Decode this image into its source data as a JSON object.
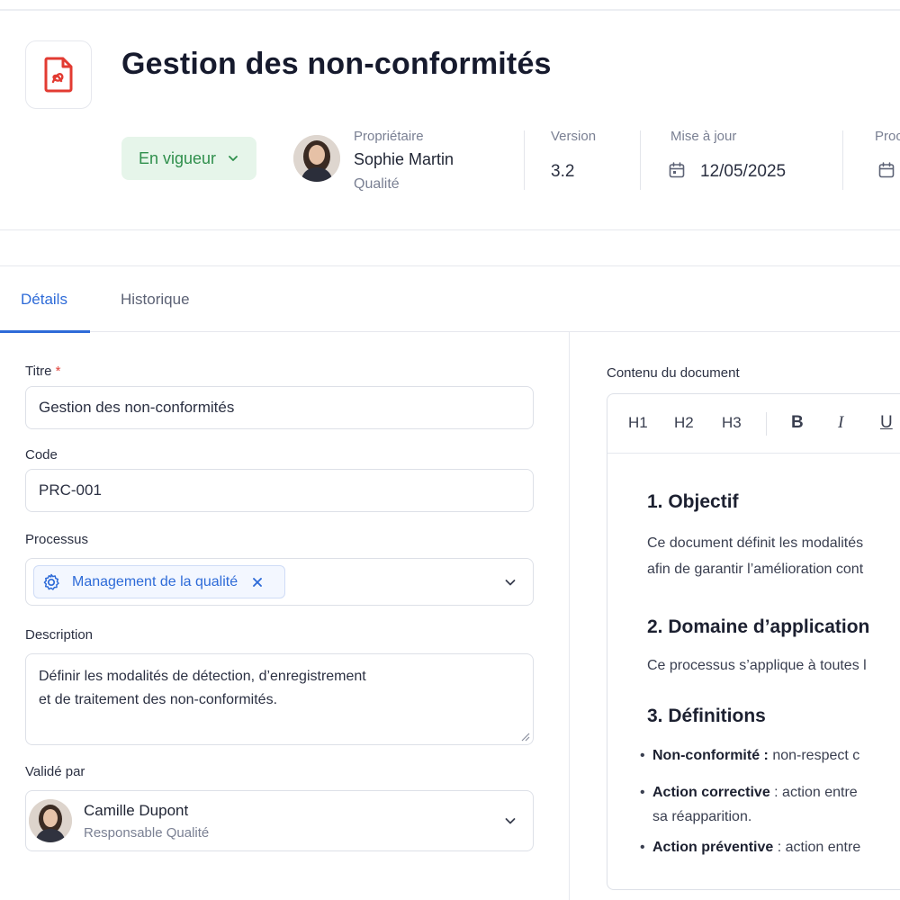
{
  "header": {
    "title": "Gestion des non-conformités",
    "status": "En vigueur",
    "owner_label": "Propriétaire",
    "owner_name": "Sophie Martin",
    "owner_department": "Qualité",
    "version_label": "Version",
    "version_value": "3.2",
    "updated_label": "Mise à jour",
    "updated_value": "12/05/2025",
    "next_label": "Proc"
  },
  "tabs": [
    {
      "label": "Détails",
      "active": true
    },
    {
      "label": "Historique",
      "active": false
    }
  ],
  "form": {
    "title_label": "Titre",
    "title_required": "*",
    "title_value": "Gestion des non-conformités",
    "code_label": "Code",
    "code_value": "PRC-001",
    "process_label": "Processus",
    "process_chip": "Management de la qualité",
    "description_label": "Description",
    "description_line1": "Définir les modalités de détection, d’enregistrement",
    "description_line2": "et de traitement des non-conformités.",
    "validated_label": "Validé par",
    "validator_name": "Camille Dupont",
    "validator_role": "Responsable Qualité"
  },
  "editor": {
    "label": "Contenu du document",
    "toolbar": [
      "H1",
      "H2",
      "H3",
      "B",
      "I",
      "U"
    ],
    "h1": "1. Objectif",
    "p1_line1": "Ce document définit les modalités",
    "p1_line2": "afin de garantir l’amélioration cont",
    "h2": "2. Domaine d’application",
    "p2": "Ce processus s’applique à toutes l",
    "h3": "3. Définitions",
    "defs": [
      {
        "term": "Non-conformité :",
        "text": " non-respect c"
      },
      {
        "term": "Action corrective",
        "text": " : action entre",
        "cont": "sa réapparition."
      },
      {
        "term": "Action préventive",
        "text": " : action entre"
      }
    ]
  },
  "colors": {
    "accent": "#2e6bd8",
    "status_bg": "#e6f5ea",
    "status_text": "#2f8f4c",
    "pdf_red": "#e23b32",
    "required": "#e0443c"
  }
}
